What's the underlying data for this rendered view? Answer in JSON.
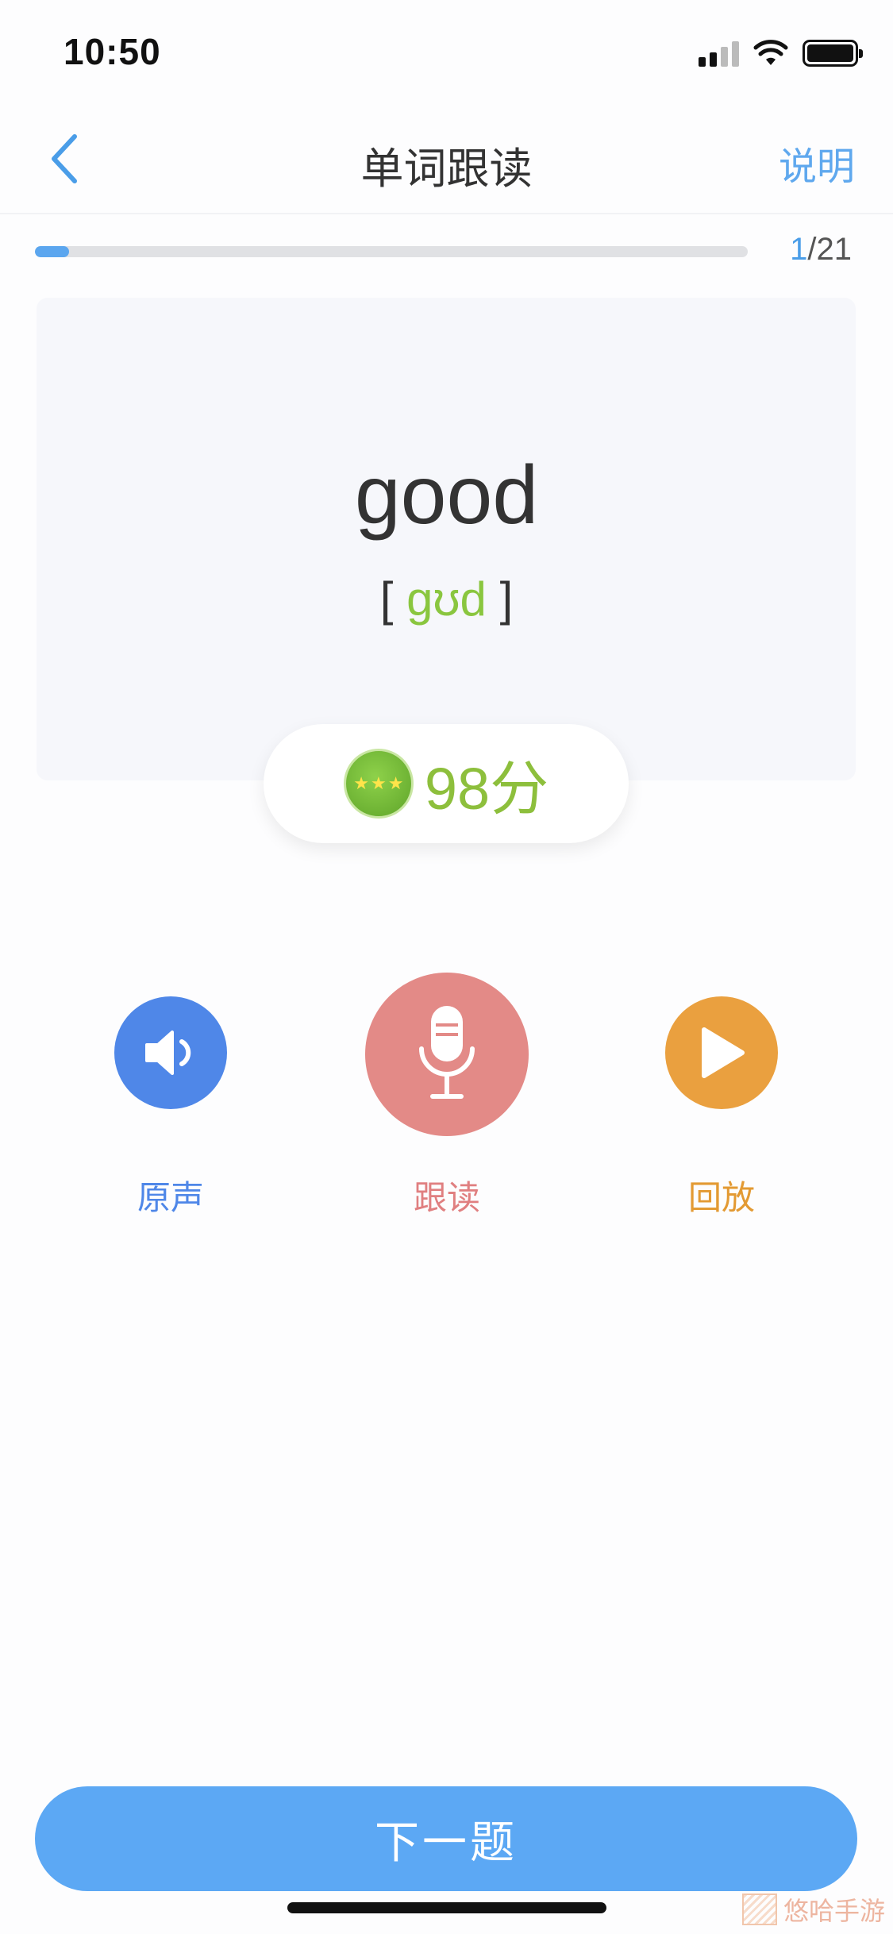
{
  "status_bar": {
    "time": "10:50"
  },
  "nav": {
    "title": "单词跟读",
    "help_label": "说明"
  },
  "progress": {
    "current": "1",
    "total": "/21",
    "fraction": 0.048
  },
  "word": {
    "text": "good",
    "bracket_open": "[",
    "phonetic": "gʊd",
    "bracket_close": "]"
  },
  "score": {
    "label": "98分",
    "stars": 3
  },
  "actions": {
    "original_label": "原声",
    "follow_label": "跟读",
    "playback_label": "回放"
  },
  "next_button": {
    "label": "下一题"
  },
  "watermark": {
    "text": "悠哈手游"
  },
  "colors": {
    "accent": "#5ca8f4",
    "original": "#4f87e8",
    "follow": "#e38a87",
    "playback": "#eaa03f",
    "score": "#8dbf3c"
  }
}
